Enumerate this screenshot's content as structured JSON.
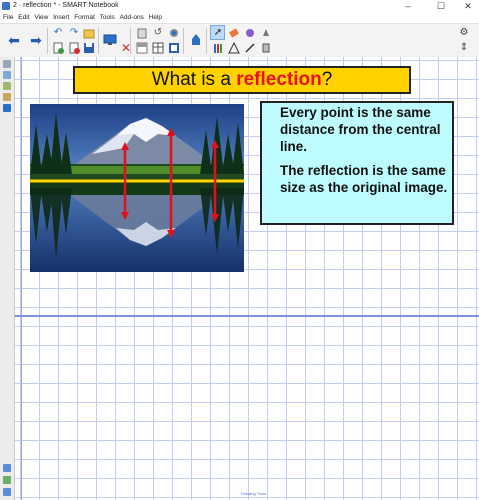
{
  "window": {
    "title": "2 · reflection * - SMART Notebook",
    "controls": {
      "minimize": "–",
      "maximize": "☐",
      "close": "✕"
    }
  },
  "menu": {
    "items": [
      {
        "label": "File"
      },
      {
        "label": "Edit"
      },
      {
        "label": "View"
      },
      {
        "label": "Insert"
      },
      {
        "label": "Format"
      },
      {
        "label": "Tools"
      },
      {
        "label": "Add-ons"
      },
      {
        "label": "Help"
      }
    ]
  },
  "toolbar": {
    "tools": [
      "back",
      "forward",
      "undo",
      "redo",
      "add-page",
      "open",
      "delete",
      "screen-shade",
      "table",
      "save",
      "paste",
      "fullscreen",
      "document-camera",
      "select",
      "pens",
      "eraser",
      "lines",
      "shapes",
      "text",
      "properties",
      "toolbar-settings",
      "toolbar-move"
    ],
    "selected": "select"
  },
  "slide": {
    "heading_before": "What is a ",
    "heading_highlight": "reflection",
    "heading_after": "?",
    "point1": "Every point is the same distance from the central line.",
    "point2": "The reflection is the same size as the original image.",
    "photo_subject": "mountain reflected in lake",
    "page_label": "Drawing Tools"
  },
  "colors": {
    "heading_bg": "#ffd200",
    "heading_highlight": "#e8141c",
    "textbox_bg": "#bdfbff",
    "grid": "#c3cdf0",
    "arrow": "#e3101a",
    "center_line": "#ffd400"
  }
}
